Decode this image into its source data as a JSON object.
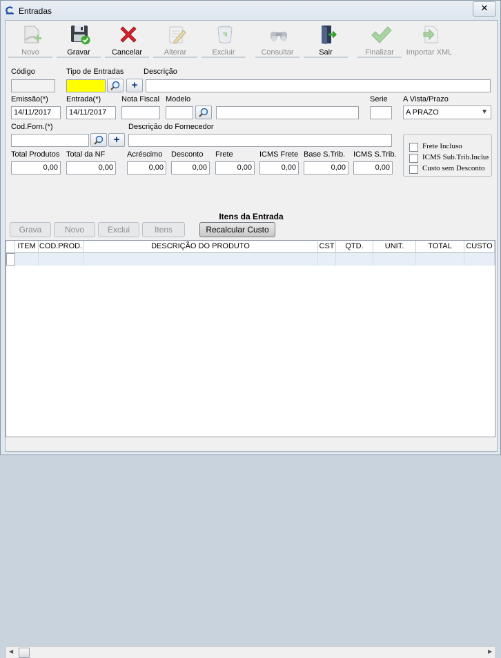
{
  "window": {
    "title": "Entradas",
    "close_label": "X"
  },
  "toolbar": [
    {
      "label": "Novo",
      "icon": "new-document-icon",
      "enabled": false
    },
    {
      "label": "Gravar",
      "icon": "floppy-save-icon",
      "enabled": true
    },
    {
      "label": "Cancelar",
      "icon": "red-x-cancel-icon",
      "enabled": true
    },
    {
      "label": "Alterar",
      "icon": "edit-pencil-icon",
      "enabled": false
    },
    {
      "label": "Excluir",
      "icon": "trash-can-icon",
      "enabled": false
    },
    {
      "label": "Consultar",
      "icon": "binoculars-icon",
      "enabled": false
    },
    {
      "label": "Sair",
      "icon": "exit-door-icon",
      "enabled": true
    },
    {
      "label": "Finalizar",
      "icon": "check-mark-icon",
      "enabled": false
    },
    {
      "label": "Importar XML",
      "icon": "import-xml-icon",
      "enabled": false
    }
  ],
  "form": {
    "codigo_label": "Código",
    "codigo_value": "",
    "tipo_label": "Tipo de Entradas",
    "tipo_value": "",
    "descricao_label": "Descrição",
    "descricao_value": "",
    "emissao_label": "Emissão(*)",
    "emissao_value": "14/11/2017",
    "entrada_label": "Entrada(*)",
    "entrada_value": "14/11/2017",
    "nota_label": "Nota Fiscal",
    "nota_value": "",
    "modelo_label": "Modelo",
    "modelo_value": "",
    "modelo_desc": "",
    "serie_label": "Serie",
    "serie_value": "",
    "avista_label": "A Vista/Prazo",
    "avista_value": "A PRAZO",
    "codforn_label": "Cod.Forn.(*)",
    "codforn_value": "",
    "descforn_label": "Descrição do Fornecedor",
    "descforn_value": "",
    "total_produtos_label": "Total Produtos",
    "total_produtos_value": "0,00",
    "total_nf_label": "Total da NF",
    "total_nf_value": "0,00",
    "acrescimo_label": "Acréscimo",
    "acrescimo_value": "0,00",
    "desconto_label": "Desconto",
    "desconto_value": "0,00",
    "frete_label": "Frete",
    "frete_value": "0,00",
    "icms_frete_label": "ICMS Frete",
    "icms_frete_value": "0,00",
    "base_st_label": "Base S.Trib.",
    "base_st_value": "0,00",
    "icms_st_label": "ICMS S.Trib.",
    "icms_st_value": "0,00"
  },
  "options": [
    {
      "label": "Frete Incluso",
      "checked": false
    },
    {
      "label": "ICMS Sub.Trib.Incluso",
      "checked": false
    },
    {
      "label": "Custo sem Desconto",
      "checked": false
    }
  ],
  "items_section": {
    "title": "Itens da Entrada",
    "buttons": {
      "grava": "Grava",
      "novo": "Novo",
      "exclui": "Exclui",
      "itens": "Itens",
      "recalcular": "Recalcular Custo"
    }
  },
  "grid": {
    "columns": [
      "ITEM",
      "COD.PROD.",
      "DESCRIÇÃO DO PRODUTO",
      "CST",
      "QTD.",
      "UNIT.",
      "TOTAL",
      "CUSTO"
    ],
    "rows": []
  }
}
